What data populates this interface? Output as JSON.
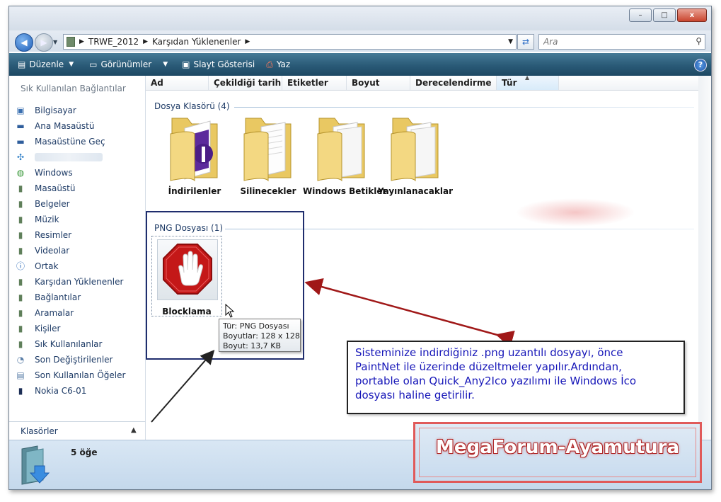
{
  "window": {
    "controls": {
      "minimize": "–",
      "maximize": "□",
      "close": "x"
    }
  },
  "address": {
    "segments": [
      "TRWE_2012",
      "Karşıdan Yüklenenler"
    ],
    "search_placeholder": "Ara"
  },
  "toolbar": {
    "items": [
      "Düzenle",
      "Görünümler",
      "Slayt Gösterisi",
      "Yaz"
    ],
    "help": "?"
  },
  "sidebar": {
    "heading": "Sık Kullanılan Bağlantılar",
    "items": [
      {
        "label": "Bilgisayar",
        "icon": "computer-icon"
      },
      {
        "label": "Ana Masaüstü",
        "icon": "desktop-icon"
      },
      {
        "label": "Masaüstüne Geç",
        "icon": "desktop-switch-icon"
      },
      {
        "label": "",
        "icon": "network-icon"
      },
      {
        "label": "Windows",
        "icon": "windows-icon"
      },
      {
        "label": "Masaüstü",
        "icon": "folder-icon"
      },
      {
        "label": "Belgeler",
        "icon": "folder-icon"
      },
      {
        "label": "Müzik",
        "icon": "folder-icon"
      },
      {
        "label": "Resimler",
        "icon": "folder-icon"
      },
      {
        "label": "Videolar",
        "icon": "folder-icon"
      },
      {
        "label": "Ortak",
        "icon": "info-icon"
      },
      {
        "label": "Karşıdan Yüklenenler",
        "icon": "folder-icon"
      },
      {
        "label": "Bağlantılar",
        "icon": "folder-icon"
      },
      {
        "label": "Aramalar",
        "icon": "folder-icon"
      },
      {
        "label": "Kişiler",
        "icon": "folder-icon"
      },
      {
        "label": "Sık Kullanılanlar",
        "icon": "folder-icon"
      },
      {
        "label": "Son Değiştirilenler",
        "icon": "recent-icon"
      },
      {
        "label": "Son Kullanılan Öğeler",
        "icon": "recent-items-icon"
      },
      {
        "label": "Nokia C6-01",
        "icon": "phone-icon"
      }
    ],
    "folders_label": "Klasörler"
  },
  "columns": [
    "Ad",
    "Çekildiği tarih",
    "Etiketler",
    "Boyut",
    "Derecelendirme",
    "Tür"
  ],
  "groups": {
    "folders_title": "Dosya Klasörü (4)",
    "png_title": "PNG Dosyası (1)"
  },
  "folders": [
    "İndirilenler",
    "Silinecekler",
    "Windows Betikler",
    "Yayınlanacaklar"
  ],
  "png_file": {
    "name": "Blocklama",
    "tooltip": {
      "type": "Tür: PNG Dosyası",
      "dimensions": "Boyutlar: 128 x 128",
      "size": "Boyut: 13,7 KB"
    }
  },
  "status": {
    "count": "5 öğe"
  },
  "annotation": {
    "lines": [
      "Sisteminize indirdiğiniz .png uzantılı dosyayı, önce",
      "PaintNet ile üzerinde düzeltmeler yapılır.Ardından,",
      "portable olan Quick_Any2Ico yazılımı ile Windows İco",
      "dosyası haline getirilir."
    ],
    "color": "#1616b8"
  },
  "watermark": "MegaForum-Ayamutura"
}
